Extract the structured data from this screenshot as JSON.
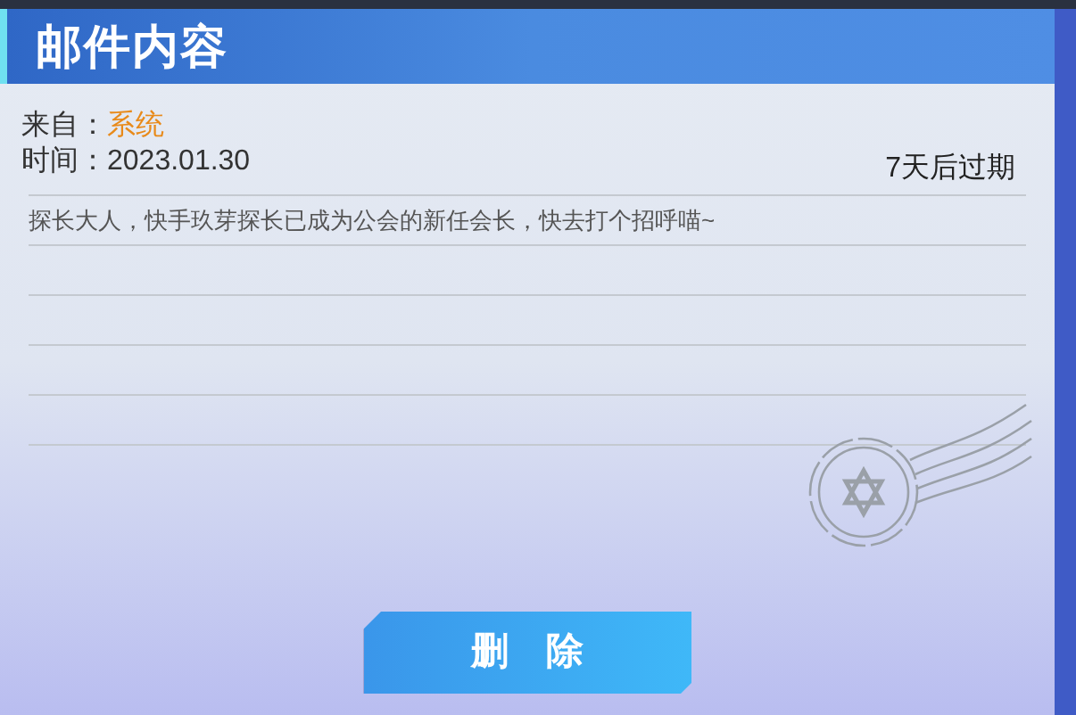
{
  "window": {
    "title": "邮件内容"
  },
  "mail": {
    "from_label": "来自：",
    "from_value": "系统",
    "time_label": "时间：",
    "time_value": "2023.01.30",
    "expiry": "7天后过期",
    "body": "探长大人，快手玖芽探长已成为公会的新任会长，快去打个招呼喵~"
  },
  "delete_button": {
    "label": "删　除"
  }
}
